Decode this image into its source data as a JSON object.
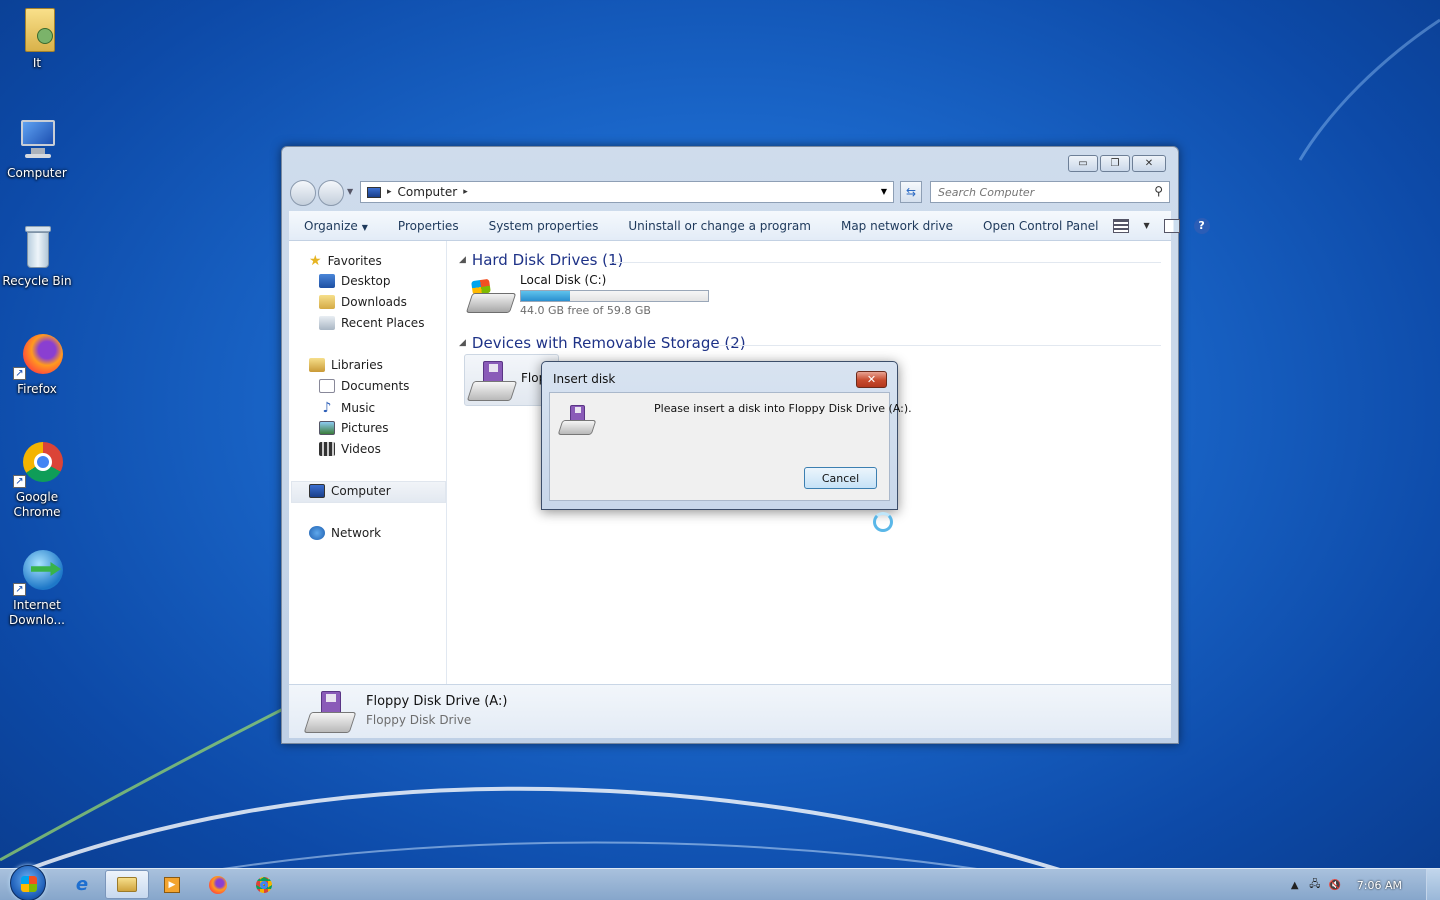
{
  "desktop": {
    "icons": [
      {
        "label": "It",
        "icon": "user-folder-icon"
      },
      {
        "label": "Computer",
        "icon": "computer-icon"
      },
      {
        "label": "Recycle Bin",
        "icon": "recycle-bin-icon"
      },
      {
        "label": "Firefox",
        "icon": "firefox-icon"
      },
      {
        "label": "Google Chrome",
        "icon": "chrome-icon"
      },
      {
        "label": "Internet Downlo...",
        "icon": "internet-download-manager-icon"
      }
    ]
  },
  "explorer": {
    "address": {
      "crumb": "Computer"
    },
    "search": {
      "placeholder": "Search Computer"
    },
    "toolbar": {
      "organize": "Organize",
      "properties": "Properties",
      "system_properties": "System properties",
      "uninstall": "Uninstall or change a program",
      "map_drive": "Map network drive",
      "control_panel": "Open Control Panel"
    },
    "nav": {
      "favorites": "Favorites",
      "desktop": "Desktop",
      "downloads": "Downloads",
      "recent": "Recent Places",
      "libraries": "Libraries",
      "documents": "Documents",
      "music": "Music",
      "pictures": "Pictures",
      "videos": "Videos",
      "computer": "Computer",
      "network": "Network"
    },
    "groups": {
      "hdd": "Hard Disk Drives (1)",
      "removable": "Devices with Removable Storage (2)"
    },
    "drives": {
      "c_name": "Local Disk (C:)",
      "c_space": "44.0 GB free of 59.8 GB",
      "c_used_fraction": 0.26,
      "floppy_partial": "Flop"
    },
    "details": {
      "name": "Floppy Disk Drive (A:)",
      "type": "Floppy Disk Drive"
    }
  },
  "dialog": {
    "title": "Insert disk",
    "message": "Please insert a disk into Floppy Disk Drive (A:).",
    "cancel": "Cancel"
  },
  "taskbar": {
    "clock": "7:06 AM",
    "apps": [
      "internet-explorer-icon",
      "windows-explorer-icon",
      "media-player-icon",
      "firefox-icon",
      "chrome-icon"
    ]
  },
  "colors": {
    "desktop_blue": "#1a66c9",
    "link_blue": "#1e3287",
    "capacity_fill": "#2a8fcf"
  }
}
